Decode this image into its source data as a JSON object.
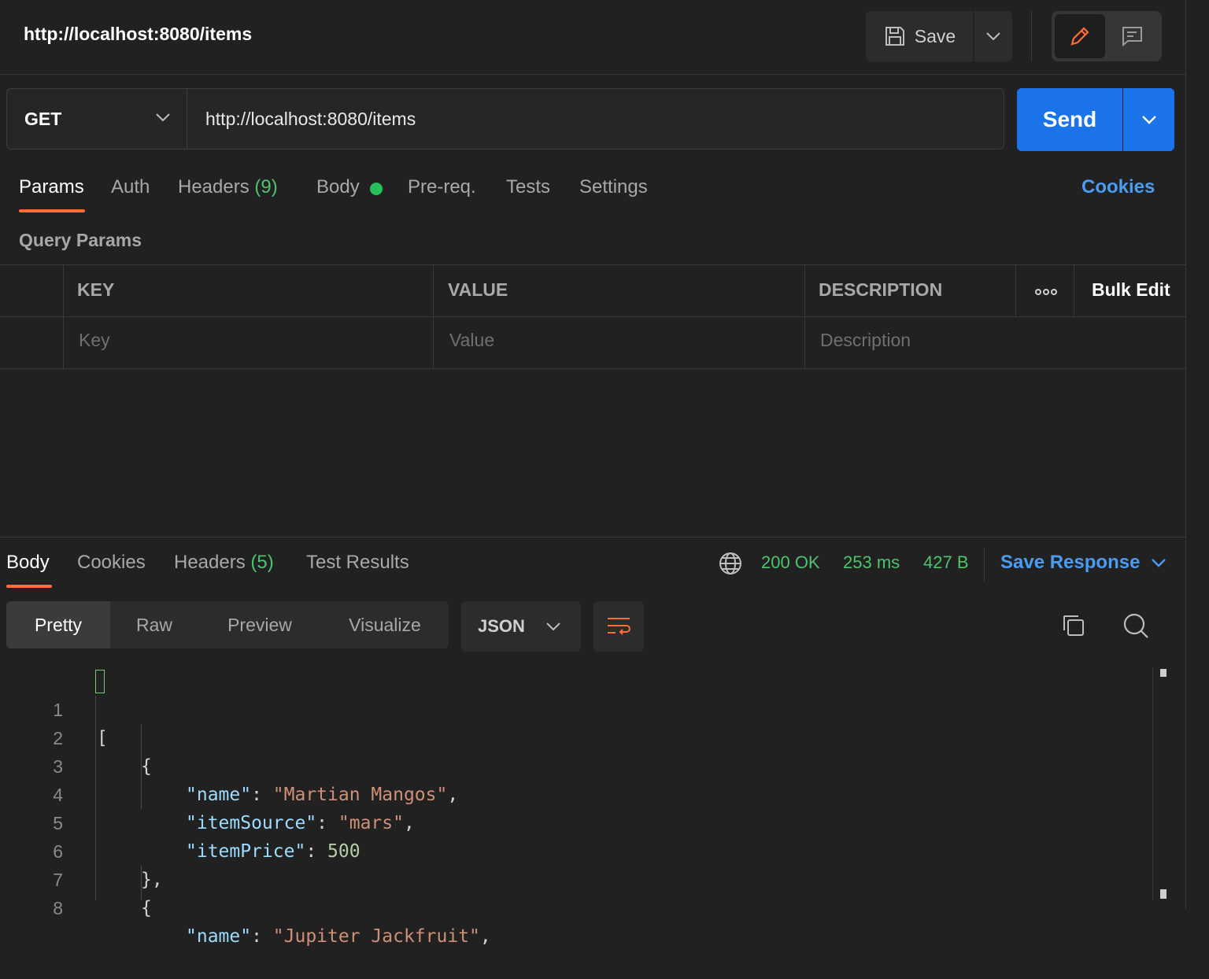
{
  "header": {
    "title": "http://localhost:8080/items",
    "save_label": "Save"
  },
  "request": {
    "method": "GET",
    "url": "http://localhost:8080/items",
    "send_label": "Send"
  },
  "request_tabs": {
    "params": "Params",
    "auth": "Auth",
    "headers": "Headers",
    "headers_count": "(9)",
    "body": "Body",
    "prereq": "Pre-req.",
    "tests": "Tests",
    "settings": "Settings",
    "cookies": "Cookies"
  },
  "params": {
    "title": "Query Params",
    "columns": {
      "key": "KEY",
      "value": "VALUE",
      "description": "DESCRIPTION",
      "bulk_edit": "Bulk Edit"
    },
    "placeholders": {
      "key": "Key",
      "value": "Value",
      "description": "Description"
    }
  },
  "response": {
    "tabs": {
      "body": "Body",
      "cookies": "Cookies",
      "headers": "Headers",
      "headers_count": "(5)",
      "test_results": "Test Results"
    },
    "status": "200 OK",
    "time": "253 ms",
    "size": "427 B",
    "save_response": "Save Response",
    "views": {
      "pretty": "Pretty",
      "raw": "Raw",
      "preview": "Preview",
      "visualize": "Visualize"
    },
    "format": "JSON",
    "code": {
      "line_numbers": [
        "1",
        "2",
        "3",
        "4",
        "5",
        "6",
        "7",
        "8"
      ],
      "l1_open": "[",
      "l2_open": "{",
      "l3_key": "\"name\"",
      "l3_val": "\"Martian Mangos\"",
      "l4_key": "\"itemSource\"",
      "l4_val": "\"mars\"",
      "l5_key": "\"itemPrice\"",
      "l5_val": "500",
      "l6_close": "},",
      "l7_open": "{",
      "l8_key": "\"name\"",
      "l8_val": "\"Jupiter Jackfruit\""
    }
  },
  "colors": {
    "background": "#212121",
    "accent_orange": "#ff6c37",
    "primary_blue": "#1a73e8",
    "link_blue": "#4a9cf0",
    "success_green": "#4fc26d"
  }
}
